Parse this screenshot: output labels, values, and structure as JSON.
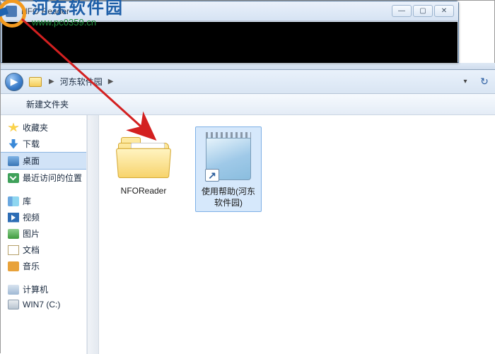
{
  "nfo": {
    "title": "NFO Reader"
  },
  "watermark": {
    "cn": "河东软件园",
    "url": "www.pc0359.cn"
  },
  "explorer": {
    "path": {
      "root": "",
      "current": "河东软件园"
    },
    "toolbar": {
      "newFolder": "新建文件夹"
    },
    "sidebar": {
      "favorites": {
        "head": "收藏夹",
        "download": "下载",
        "desktop": "桌面",
        "recent": "最近访问的位置"
      },
      "libraries": {
        "head": "库",
        "video": "视频",
        "pictures": "图片",
        "documents": "文档",
        "music": "音乐"
      },
      "computer": {
        "head": "计算机",
        "drive": "WIN7 (C:)"
      }
    },
    "files": {
      "folder": "NFOReader",
      "shortcut": "使用帮助(河东软件园)"
    }
  }
}
